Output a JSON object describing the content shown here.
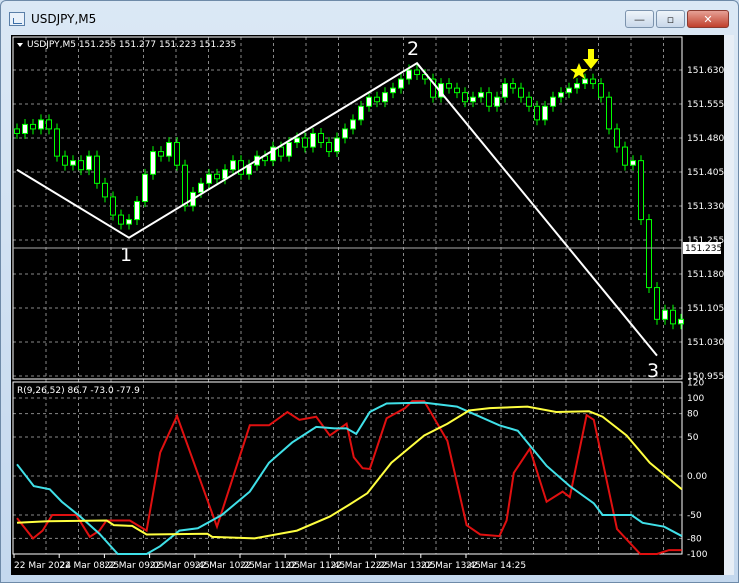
{
  "window": {
    "title": "USDJPY,M5",
    "minimize": "—",
    "maximize": "▫",
    "close": "✕"
  },
  "chart": {
    "header": "USDJPY,M5  151.255 151.277 151.223 151.235",
    "current_price": "151.235",
    "price_labels": [
      "151.630",
      "151.555",
      "151.480",
      "151.405",
      "151.330",
      "151.255",
      "151.180",
      "151.105",
      "151.030",
      "150.955"
    ],
    "time_labels": [
      "22 Mar 2024",
      "22 Mar 08:25",
      "22 Mar 09:05",
      "22 Mar 09:45",
      "22 Mar 10:25",
      "22 Mar 11:05",
      "22 Mar 11:45",
      "22 Mar 12:25",
      "22 Mar 13:05",
      "22 Mar 13:45",
      "22 Mar 14:25"
    ],
    "wave_labels": [
      "1",
      "2",
      "3"
    ],
    "indicator_header": "R(9,26,52) 86.7 -73.0 -77.9",
    "indicator_labels": [
      "120",
      "100",
      "80",
      "50",
      "0.00",
      "-50",
      "-80",
      "-100"
    ],
    "colors": {
      "bull": "#00ff00",
      "candle_body": "#ffffff",
      "zigzag": "#ffffff",
      "marker": "#ffff00",
      "red": "#e01010",
      "cyan": "#40e0e8",
      "yellow": "#ffff40"
    }
  },
  "chart_data": {
    "type": "line",
    "candles_close": [
      151.49,
      151.51,
      151.5,
      151.52,
      151.5,
      151.44,
      151.42,
      151.43,
      151.41,
      151.44,
      151.38,
      151.35,
      151.31,
      151.29,
      151.3,
      151.34,
      151.4,
      151.45,
      151.44,
      151.47,
      151.42,
      151.33,
      151.36,
      151.38,
      151.4,
      151.39,
      151.41,
      151.43,
      151.4,
      151.42,
      151.44,
      151.43,
      151.46,
      151.44,
      151.47,
      151.48,
      151.46,
      151.49,
      151.47,
      151.45,
      151.48,
      151.5,
      151.52,
      151.55,
      151.57,
      151.56,
      151.58,
      151.59,
      151.61,
      151.63,
      151.62,
      151.61,
      151.57,
      151.6,
      151.59,
      151.58,
      151.56,
      151.57,
      151.58,
      151.55,
      151.57,
      151.6,
      151.59,
      151.57,
      151.55,
      151.52,
      151.55,
      151.57,
      151.58,
      151.59,
      151.6,
      151.61,
      151.6,
      151.57,
      151.5,
      151.46,
      151.42,
      151.43,
      151.3,
      151.15,
      151.08,
      151.1,
      151.07,
      151.08
    ],
    "price_range": [
      150.955,
      151.68
    ],
    "zigzag": [
      [
        0,
        151.41
      ],
      [
        14,
        151.26
      ],
      [
        50,
        151.645
      ],
      [
        80,
        151.0
      ]
    ],
    "indicator_range": [
      -100,
      120
    ],
    "series": [
      {
        "name": "red",
        "points": [
          [
            0,
            -54
          ],
          [
            2,
            -80
          ],
          [
            3.2,
            -70
          ],
          [
            4.4,
            -50
          ],
          [
            7.4,
            -50
          ],
          [
            9.1,
            -78
          ],
          [
            10.3,
            -70
          ],
          [
            11.2,
            -57
          ],
          [
            14.1,
            -57
          ],
          [
            16.2,
            -70
          ],
          [
            17.9,
            30
          ],
          [
            20,
            77
          ],
          [
            25,
            -65
          ],
          [
            29.1,
            65
          ],
          [
            31.5,
            65
          ],
          [
            33.8,
            82
          ],
          [
            35.3,
            72
          ],
          [
            37.4,
            76
          ],
          [
            39.1,
            52
          ],
          [
            41.2,
            67
          ],
          [
            42.1,
            24
          ],
          [
            43.2,
            10
          ],
          [
            44.1,
            9
          ],
          [
            46.2,
            74
          ],
          [
            48.5,
            87
          ],
          [
            49.4,
            96
          ],
          [
            50.9,
            96
          ],
          [
            53.8,
            45
          ],
          [
            56.2,
            -63
          ],
          [
            57.9,
            -75
          ],
          [
            60.3,
            -77
          ],
          [
            61.2,
            -57
          ],
          [
            62.1,
            4
          ],
          [
            64.1,
            35
          ],
          [
            66.2,
            -33
          ],
          [
            68.2,
            -20
          ],
          [
            69.1,
            -27
          ],
          [
            71.2,
            78
          ],
          [
            72.1,
            72
          ],
          [
            75,
            -68
          ],
          [
            77.9,
            -100
          ],
          [
            80,
            -100
          ],
          [
            81.5,
            -95
          ],
          [
            83.1,
            -95
          ]
        ]
      },
      {
        "name": "cyan",
        "points": [
          [
            0,
            15
          ],
          [
            2.1,
            -13
          ],
          [
            4.1,
            -17
          ],
          [
            5.6,
            -33
          ],
          [
            7.9,
            -52
          ],
          [
            10.3,
            -74
          ],
          [
            12.6,
            -100
          ],
          [
            16.2,
            -100
          ],
          [
            17.9,
            -90
          ],
          [
            20.3,
            -70
          ],
          [
            22.6,
            -67
          ],
          [
            25.6,
            -50
          ],
          [
            29.1,
            -20
          ],
          [
            31.5,
            17
          ],
          [
            34.4,
            43
          ],
          [
            37.4,
            63
          ],
          [
            39.7,
            61
          ],
          [
            41.2,
            61
          ],
          [
            42.4,
            54
          ],
          [
            44.1,
            82
          ],
          [
            46.2,
            93
          ],
          [
            50.9,
            94
          ],
          [
            55,
            89
          ],
          [
            60.3,
            65
          ],
          [
            62.6,
            58
          ],
          [
            66.2,
            13
          ],
          [
            69.1,
            -13
          ],
          [
            72.1,
            -35
          ],
          [
            73.2,
            -50
          ],
          [
            76.8,
            -50
          ],
          [
            78.2,
            -60
          ],
          [
            80.9,
            -65
          ],
          [
            83.1,
            -77
          ]
        ]
      },
      {
        "name": "yellow",
        "points": [
          [
            0,
            -60
          ],
          [
            3.8,
            -58
          ],
          [
            11.2,
            -57
          ],
          [
            12.1,
            -63
          ],
          [
            14.4,
            -64
          ],
          [
            16.2,
            -75
          ],
          [
            23.8,
            -74
          ],
          [
            24.4,
            -78
          ],
          [
            29.7,
            -80
          ],
          [
            35,
            -70
          ],
          [
            39.1,
            -52
          ],
          [
            41.5,
            -37
          ],
          [
            43.8,
            -22
          ],
          [
            46.8,
            17
          ],
          [
            50.9,
            52
          ],
          [
            53.8,
            67
          ],
          [
            56.5,
            84
          ],
          [
            59.1,
            87
          ],
          [
            63.8,
            89
          ],
          [
            67.4,
            82
          ],
          [
            71.5,
            83
          ],
          [
            73.2,
            76
          ],
          [
            76.2,
            52
          ],
          [
            79.1,
            17
          ],
          [
            83.1,
            -17
          ]
        ]
      }
    ]
  }
}
